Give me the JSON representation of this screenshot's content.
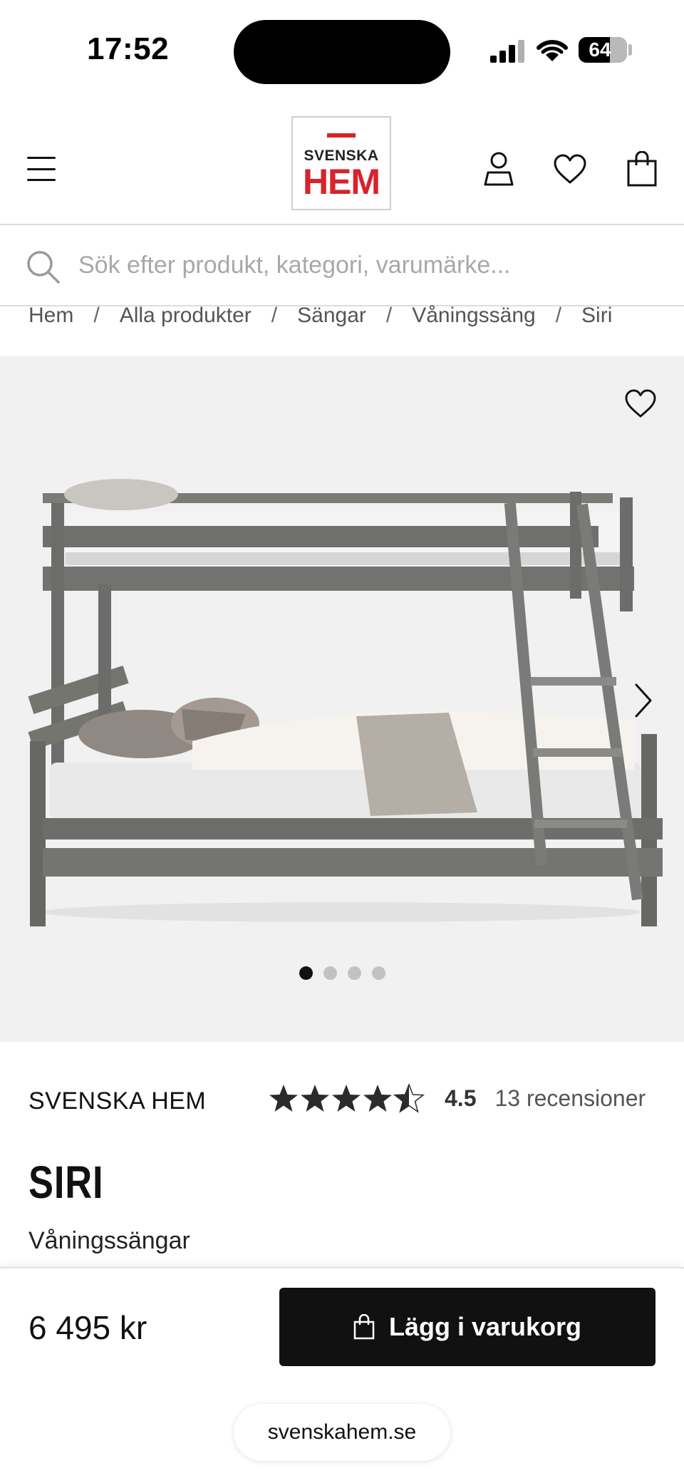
{
  "status_bar": {
    "time": "17:52",
    "battery": "64",
    "battery_level": 0.64
  },
  "header": {
    "logo_top": "SVENSKA",
    "logo_main": "HEM",
    "brand_red": "#d9222a"
  },
  "search": {
    "placeholder": "Sök efter produkt, kategori, varumärke..."
  },
  "breadcrumb": [
    "Hem",
    "Alla produkter",
    "Sängar",
    "Våningssäng",
    "Siri"
  ],
  "gallery": {
    "image_count": 4,
    "active_index": 0
  },
  "product": {
    "brand": "SVENSKA HEM",
    "rating_value": "4.5",
    "rating_stars": 4.5,
    "review_count": "13 recensioner",
    "title": "SIRI",
    "category": "Våningssängar"
  },
  "purchase": {
    "price": "6 495 kr",
    "add_to_cart_label": "Lägg i varukorg"
  },
  "browser": {
    "url": "svenskahem.se"
  }
}
